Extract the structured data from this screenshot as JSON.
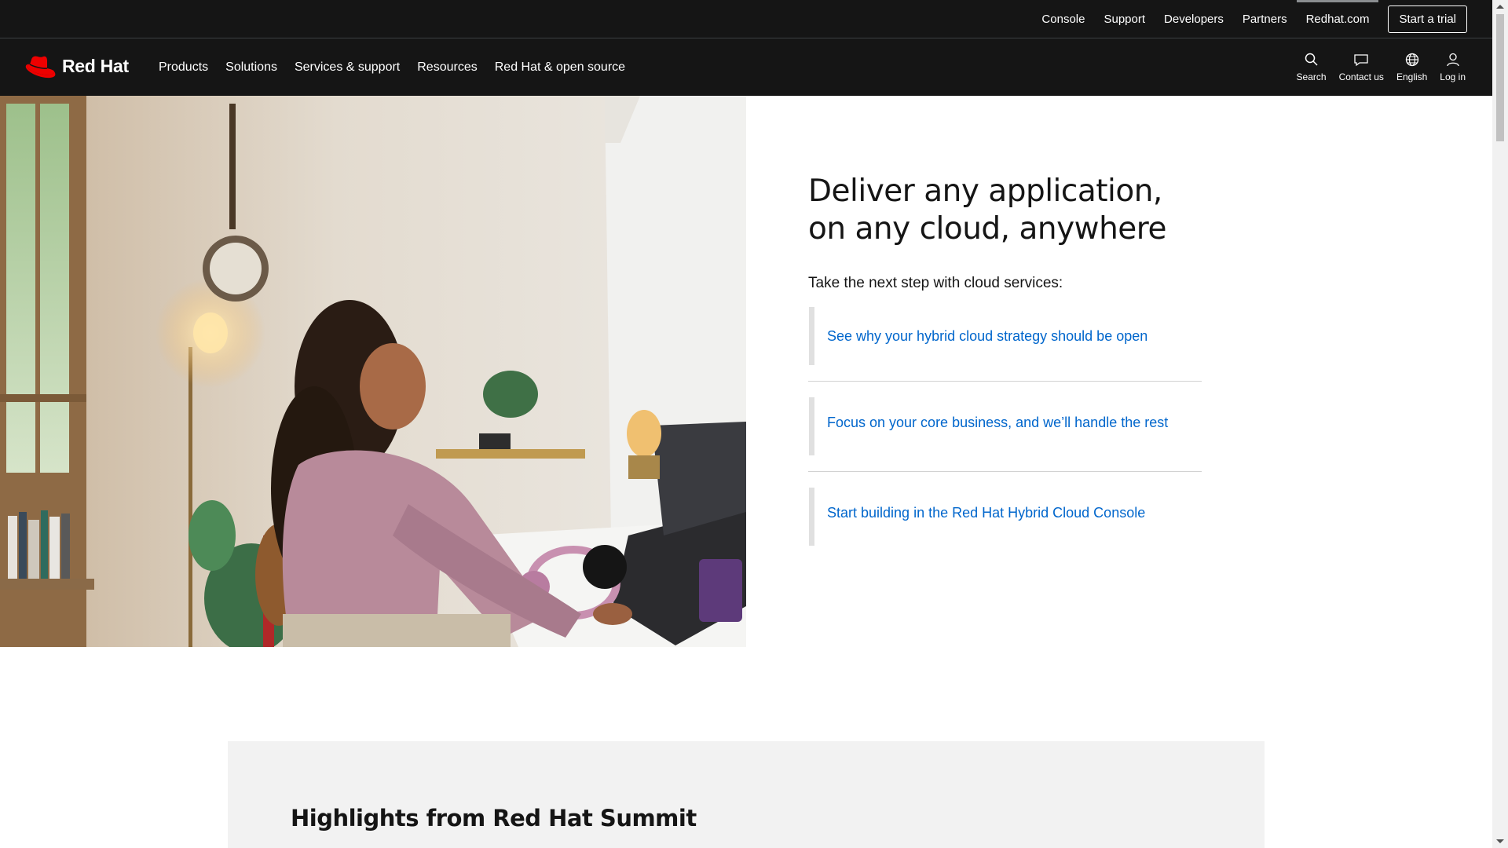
{
  "utility_bar": {
    "links": [
      "Console",
      "Support",
      "Developers",
      "Partners",
      "Redhat.com"
    ],
    "trial_label": "Start a trial"
  },
  "nav": {
    "logo_text": "Red Hat",
    "items": [
      "Products",
      "Solutions",
      "Services & support",
      "Resources",
      "Red Hat & open source"
    ],
    "tools": {
      "search": "Search",
      "contact": "Contact us",
      "language": "English",
      "login": "Log in"
    }
  },
  "hero": {
    "title_line1": "Deliver any application,",
    "title_line2": "on any cloud, anywhere",
    "subtitle": "Take the next step with cloud services:",
    "links": [
      "See why your hybrid cloud strategy should be open",
      "Focus on your core business, and we’ll handle the rest",
      "Start building in the Red Hat Hybrid Cloud Console"
    ]
  },
  "highlights": {
    "title": "Highlights from Red Hat Summit"
  },
  "colors": {
    "header_bg": "#151515",
    "link": "#0066cc",
    "brand_red": "#ee0000",
    "panel_bg": "#f2f2f2"
  }
}
